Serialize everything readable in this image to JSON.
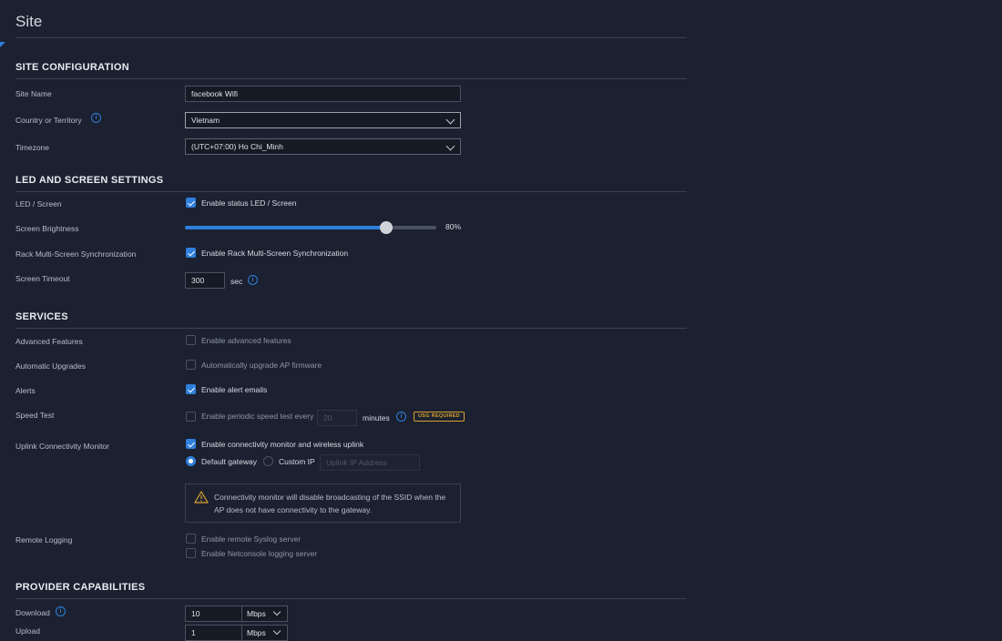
{
  "page": {
    "title": "Site"
  },
  "colors": {
    "accent": "#2f7fdc",
    "warning": "#d9a22e",
    "background": "#1b2130"
  },
  "site_configuration": {
    "heading": "SITE CONFIGURATION",
    "site_name_label": "Site Name",
    "site_name_value": "facebook Wifi",
    "country_label": "Country or Territory",
    "country_value": "Vietnam",
    "timezone_label": "Timezone",
    "timezone_value": "(UTC+07:00) Ho Chi_Minh"
  },
  "led_screen": {
    "heading": "LED AND SCREEN SETTINGS",
    "led_label": "LED / Screen",
    "led_checkbox_label": "Enable status LED / Screen",
    "led_checked": true,
    "brightness_label": "Screen Brightness",
    "brightness_percent": 80,
    "brightness_text": "80%",
    "rack_label": "Rack Multi-Screen Synchronization",
    "rack_checkbox_label": "Enable Rack Multi-Screen Synchronization",
    "rack_checked": true,
    "timeout_label": "Screen Timeout",
    "timeout_value": "300",
    "timeout_unit": "sec"
  },
  "services": {
    "heading": "SERVICES",
    "advanced_label": "Advanced Features",
    "advanced_checkbox_label": "Enable advanced features",
    "upgrades_label": "Automatic Upgrades",
    "upgrades_checkbox_label": "Automatically upgrade AP firmware",
    "alerts_label": "Alerts",
    "alerts_checkbox_label": "Enable alert emails",
    "speed_label": "Speed Test",
    "speed_checkbox_label": "Enable periodic speed test every",
    "speed_interval_value": "20",
    "speed_unit": "minutes",
    "speed_badge": "USG REQUIRED",
    "uplink_label": "Uplink Connectivity Monitor",
    "uplink_checkbox_label": "Enable connectivity monitor and wireless uplink",
    "default_gateway_label": "Default gateway",
    "custom_ip_label": "Custom IP",
    "custom_ip_placeholder": "Uplink IP Address",
    "warning_text": "Connectivity monitor will disable broadcasting of the SSID when the AP does not have connectivity to the gateway.",
    "remote_logging_label": "Remote Logging",
    "syslog_checkbox_label": "Enable remote Syslog server",
    "netconsole_checkbox_label": "Enable Netconsole logging server"
  },
  "provider": {
    "heading": "PROVIDER CAPABILITIES",
    "download_label": "Download",
    "download_value": "10",
    "download_unit": "Mbps",
    "upload_label": "Upload",
    "upload_value": "1",
    "upload_unit": "Mbps"
  }
}
